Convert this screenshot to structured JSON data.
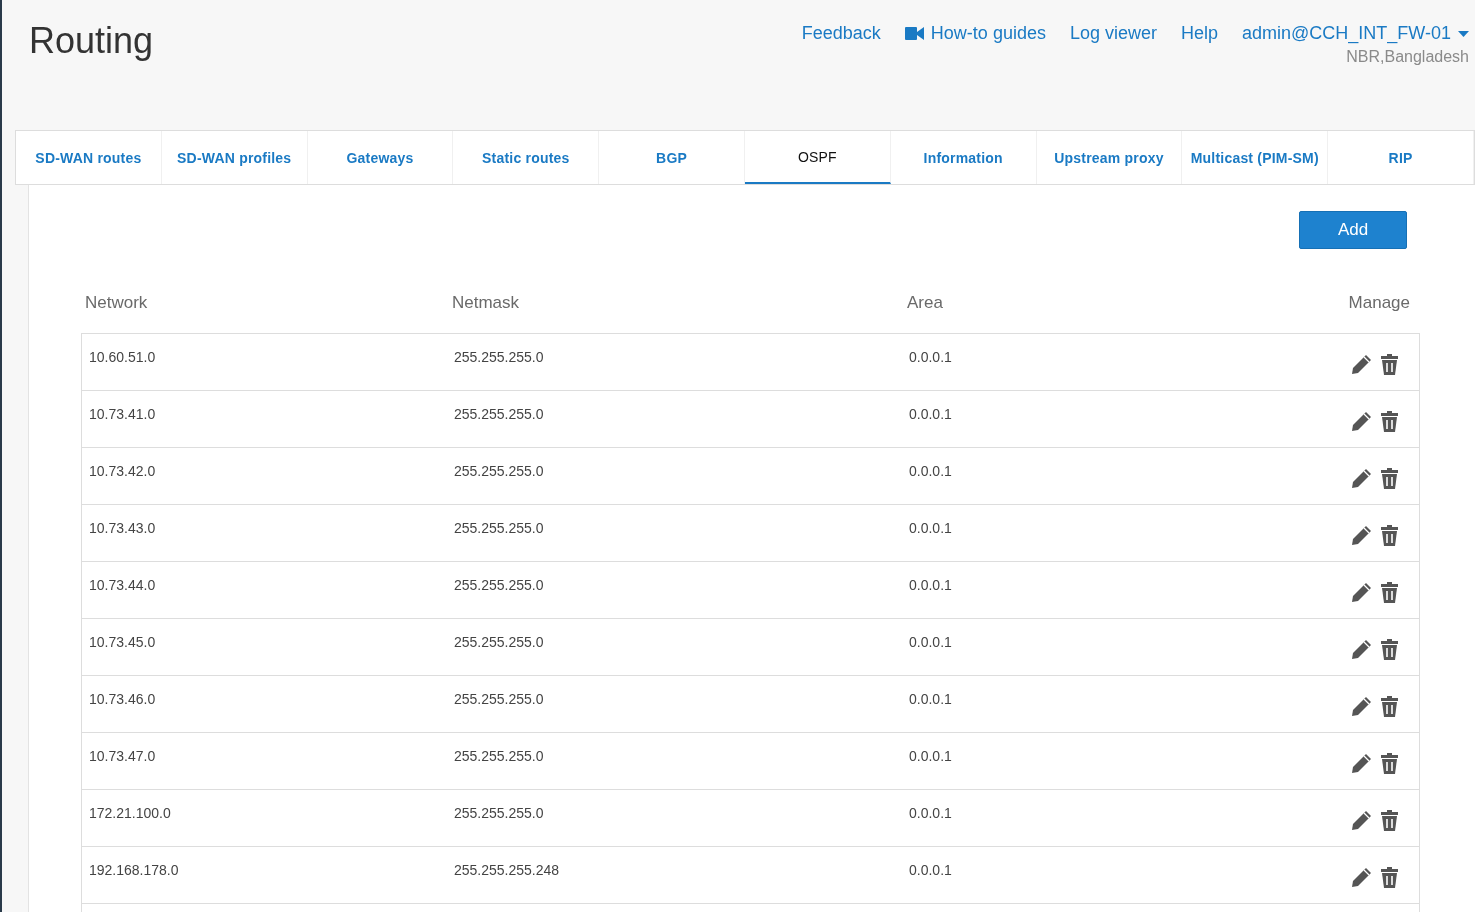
{
  "page": {
    "title": "Routing"
  },
  "header_links": [
    {
      "label": "Feedback",
      "kind": "text"
    },
    {
      "label": "How-to guides",
      "kind": "video"
    },
    {
      "label": "Log viewer",
      "kind": "text"
    },
    {
      "label": "Help",
      "kind": "text"
    }
  ],
  "user": {
    "name": "admin@CCH_INT_FW-01",
    "location": "NBR,Bangladesh"
  },
  "tabs": [
    {
      "label": "SD-WAN routes",
      "selected": false
    },
    {
      "label": "SD-WAN profiles",
      "selected": false
    },
    {
      "label": "Gateways",
      "selected": false
    },
    {
      "label": "Static routes",
      "selected": false
    },
    {
      "label": "BGP",
      "selected": false
    },
    {
      "label": "OSPF",
      "selected": true
    },
    {
      "label": "Information",
      "selected": false
    },
    {
      "label": "Upstream proxy",
      "selected": false
    },
    {
      "label": "Multicast (PIM-SM)",
      "selected": false
    },
    {
      "label": "RIP",
      "selected": false
    }
  ],
  "add_button": "Add",
  "table": {
    "columns": [
      "Network",
      "Netmask",
      "Area",
      "Manage"
    ],
    "rows": [
      {
        "network": "10.60.51.0",
        "netmask": "255.255.255.0",
        "area": "0.0.0.1"
      },
      {
        "network": "10.73.41.0",
        "netmask": "255.255.255.0",
        "area": "0.0.0.1"
      },
      {
        "network": "10.73.42.0",
        "netmask": "255.255.255.0",
        "area": "0.0.0.1"
      },
      {
        "network": "10.73.43.0",
        "netmask": "255.255.255.0",
        "area": "0.0.0.1"
      },
      {
        "network": "10.73.44.0",
        "netmask": "255.255.255.0",
        "area": "0.0.0.1"
      },
      {
        "network": "10.73.45.0",
        "netmask": "255.255.255.0",
        "area": "0.0.0.1"
      },
      {
        "network": "10.73.46.0",
        "netmask": "255.255.255.0",
        "area": "0.0.0.1"
      },
      {
        "network": "10.73.47.0",
        "netmask": "255.255.255.0",
        "area": "0.0.0.1"
      },
      {
        "network": "172.21.100.0",
        "netmask": "255.255.255.0",
        "area": "0.0.0.1"
      },
      {
        "network": "192.168.178.0",
        "netmask": "255.255.255.248",
        "area": "0.0.0.1"
      }
    ]
  }
}
